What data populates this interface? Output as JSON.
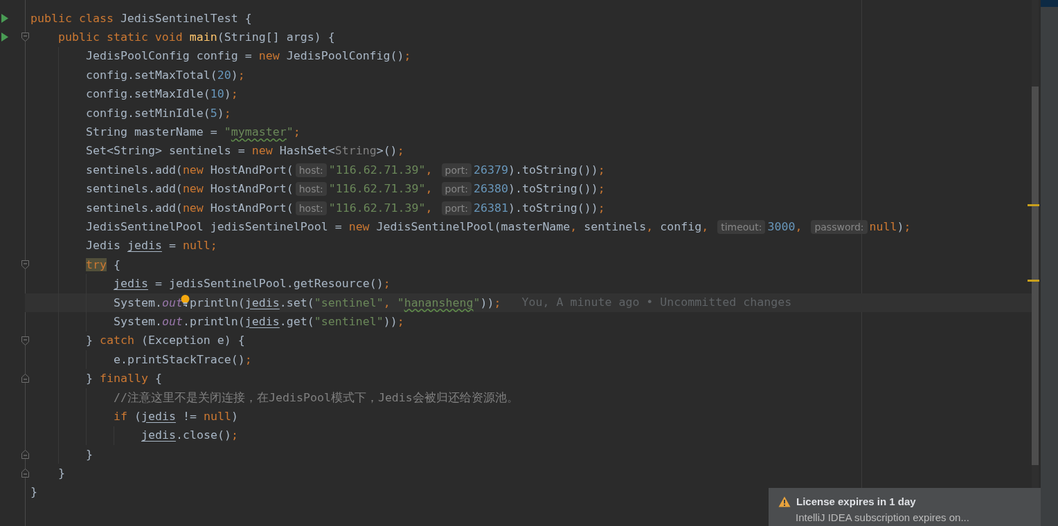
{
  "editor": {
    "lines": [
      {
        "run": true,
        "fold_start": false,
        "fold_end": false,
        "current": false,
        "tokens": [
          {
            "kind": "keyword",
            "text": "public class "
          },
          {
            "kind": "plain",
            "text": "JedisSentinelTest {"
          }
        ],
        "children": [
          {
            "run": true,
            "fold_start": true,
            "fold_end": false,
            "current": false,
            "tokens": [
              {
                "kind": "keyword",
                "text": "public static void "
              },
              {
                "kind": "method",
                "text": "main"
              },
              {
                "kind": "plain",
                "text": "(String[] args) {"
              }
            ],
            "children": [
              {
                "run": false,
                "fold_start": false,
                "fold_end": false,
                "current": false,
                "tokens": [
                  {
                    "kind": "plain",
                    "text": "JedisPoolConfig config = "
                  },
                  {
                    "kind": "keyword",
                    "text": "new "
                  },
                  {
                    "kind": "plain",
                    "text": "JedisPoolConfig()"
                  },
                  {
                    "kind": "punct",
                    "text": ";"
                  }
                ]
              },
              {
                "run": false,
                "fold_start": false,
                "fold_end": false,
                "current": false,
                "tokens": [
                  {
                    "kind": "plain",
                    "text": "config.setMaxTotal("
                  },
                  {
                    "kind": "number",
                    "text": "20"
                  },
                  {
                    "kind": "plain",
                    "text": ")"
                  },
                  {
                    "kind": "punct",
                    "text": ";"
                  }
                ]
              },
              {
                "run": false,
                "fold_start": false,
                "fold_end": false,
                "current": false,
                "tokens": [
                  {
                    "kind": "plain",
                    "text": "config.setMaxIdle("
                  },
                  {
                    "kind": "number",
                    "text": "10"
                  },
                  {
                    "kind": "plain",
                    "text": ")"
                  },
                  {
                    "kind": "punct",
                    "text": ";"
                  }
                ]
              },
              {
                "run": false,
                "fold_start": false,
                "fold_end": false,
                "current": false,
                "tokens": [
                  {
                    "kind": "plain",
                    "text": "config.setMinIdle("
                  },
                  {
                    "kind": "number",
                    "text": "5"
                  },
                  {
                    "kind": "plain",
                    "text": ")"
                  },
                  {
                    "kind": "punct",
                    "text": ";"
                  }
                ]
              },
              {
                "run": false,
                "fold_start": false,
                "fold_end": false,
                "current": false,
                "tokens": [
                  {
                    "kind": "plain",
                    "text": "String masterName = "
                  },
                  {
                    "kind": "string",
                    "text": "\""
                  },
                  {
                    "kind": "typo",
                    "text": "mymaster"
                  },
                  {
                    "kind": "string",
                    "text": "\""
                  },
                  {
                    "kind": "punct",
                    "text": ";"
                  }
                ]
              },
              {
                "run": false,
                "fold_start": false,
                "fold_end": false,
                "current": false,
                "tokens": [
                  {
                    "kind": "plain",
                    "text": "Set<String> sentinels = "
                  },
                  {
                    "kind": "keyword",
                    "text": "new "
                  },
                  {
                    "kind": "plain",
                    "text": "HashSet<"
                  },
                  {
                    "kind": "inferred",
                    "text": "String"
                  },
                  {
                    "kind": "plain",
                    "text": ">()"
                  },
                  {
                    "kind": "punct",
                    "text": ";"
                  }
                ]
              },
              {
                "run": false,
                "fold_start": false,
                "fold_end": false,
                "current": false,
                "tokens": [
                  {
                    "kind": "plain",
                    "text": "sentinels.add("
                  },
                  {
                    "kind": "keyword",
                    "text": "new "
                  },
                  {
                    "kind": "plain",
                    "text": "HostAndPort("
                  },
                  {
                    "kind": "hint",
                    "text": "host:"
                  },
                  {
                    "kind": "string",
                    "text": "\"116.62.71.39\""
                  },
                  {
                    "kind": "punct",
                    "text": ", "
                  },
                  {
                    "kind": "hint",
                    "text": "port:"
                  },
                  {
                    "kind": "number",
                    "text": "26379"
                  },
                  {
                    "kind": "plain",
                    "text": ").toString())"
                  },
                  {
                    "kind": "punct",
                    "text": ";"
                  }
                ]
              },
              {
                "run": false,
                "fold_start": false,
                "fold_end": false,
                "current": false,
                "tokens": [
                  {
                    "kind": "plain",
                    "text": "sentinels.add("
                  },
                  {
                    "kind": "keyword",
                    "text": "new "
                  },
                  {
                    "kind": "plain",
                    "text": "HostAndPort("
                  },
                  {
                    "kind": "hint",
                    "text": "host:"
                  },
                  {
                    "kind": "string",
                    "text": "\"116.62.71.39\""
                  },
                  {
                    "kind": "punct",
                    "text": ", "
                  },
                  {
                    "kind": "hint",
                    "text": "port:"
                  },
                  {
                    "kind": "number",
                    "text": "26380"
                  },
                  {
                    "kind": "plain",
                    "text": ").toString())"
                  },
                  {
                    "kind": "punct",
                    "text": ";"
                  }
                ]
              },
              {
                "run": false,
                "fold_start": false,
                "fold_end": false,
                "current": false,
                "tokens": [
                  {
                    "kind": "plain",
                    "text": "sentinels.add("
                  },
                  {
                    "kind": "keyword",
                    "text": "new "
                  },
                  {
                    "kind": "plain",
                    "text": "HostAndPort("
                  },
                  {
                    "kind": "hint",
                    "text": "host:"
                  },
                  {
                    "kind": "string",
                    "text": "\"116.62.71.39\""
                  },
                  {
                    "kind": "punct",
                    "text": ", "
                  },
                  {
                    "kind": "hint",
                    "text": "port:"
                  },
                  {
                    "kind": "number",
                    "text": "26381"
                  },
                  {
                    "kind": "plain",
                    "text": ").toString())"
                  },
                  {
                    "kind": "punct",
                    "text": ";"
                  }
                ]
              },
              {
                "run": false,
                "fold_start": false,
                "fold_end": false,
                "current": false,
                "tokens": [
                  {
                    "kind": "plain",
                    "text": "JedisSentinelPool jedisSentinelPool = "
                  },
                  {
                    "kind": "keyword",
                    "text": "new "
                  },
                  {
                    "kind": "plain",
                    "text": "JedisSentinelPool(masterName"
                  },
                  {
                    "kind": "punct",
                    "text": ", "
                  },
                  {
                    "kind": "plain",
                    "text": "sentinels"
                  },
                  {
                    "kind": "punct",
                    "text": ", "
                  },
                  {
                    "kind": "plain",
                    "text": "config"
                  },
                  {
                    "kind": "punct",
                    "text": ", "
                  },
                  {
                    "kind": "hint",
                    "text": "timeout:"
                  },
                  {
                    "kind": "number",
                    "text": "3000"
                  },
                  {
                    "kind": "punct",
                    "text": ", "
                  },
                  {
                    "kind": "hint",
                    "text": "password:"
                  },
                  {
                    "kind": "keyword",
                    "text": "null"
                  },
                  {
                    "kind": "plain",
                    "text": ")"
                  },
                  {
                    "kind": "punct",
                    "text": ";"
                  }
                ]
              },
              {
                "run": false,
                "fold_start": false,
                "fold_end": false,
                "current": false,
                "tokens": [
                  {
                    "kind": "plain",
                    "text": "Jedis "
                  },
                  {
                    "kind": "variable",
                    "text": "jedis"
                  },
                  {
                    "kind": "plain",
                    "text": " = "
                  },
                  {
                    "kind": "keyword",
                    "text": "null"
                  },
                  {
                    "kind": "punct",
                    "text": ";"
                  }
                ]
              },
              {
                "run": false,
                "fold_start": true,
                "fold_end": false,
                "current": false,
                "tokens": [
                  {
                    "kind": "keyword-match",
                    "text": "try"
                  },
                  {
                    "kind": "plain",
                    "text": " {"
                  }
                ],
                "children": [
                  {
                    "run": false,
                    "fold_start": false,
                    "fold_end": false,
                    "current": false,
                    "tokens": [
                      {
                        "kind": "variable",
                        "text": "jedis"
                      },
                      {
                        "kind": "plain",
                        "text": " = jedisSentinelPool.getResource()"
                      },
                      {
                        "kind": "punct",
                        "text": ";"
                      }
                    ]
                  },
                  {
                    "run": false,
                    "fold_start": false,
                    "fold_end": false,
                    "current": true,
                    "tokens": [
                      {
                        "kind": "plain",
                        "text": "System."
                      },
                      {
                        "kind": "field",
                        "text": "out"
                      },
                      {
                        "kind": "plain",
                        "text": ".println("
                      },
                      {
                        "kind": "variable",
                        "text": "jedis"
                      },
                      {
                        "kind": "plain",
                        "text": ".set("
                      },
                      {
                        "kind": "string",
                        "text": "\"sentinel\""
                      },
                      {
                        "kind": "punct",
                        "text": ", "
                      },
                      {
                        "kind": "string",
                        "text": "\""
                      },
                      {
                        "kind": "typo",
                        "text": "hanansheng"
                      },
                      {
                        "kind": "string",
                        "text": "\""
                      },
                      {
                        "kind": "plain",
                        "text": "))"
                      },
                      {
                        "kind": "punct",
                        "text": ";"
                      },
                      {
                        "kind": "blame",
                        "text": "You, A minute ago • Uncommitted changes"
                      }
                    ]
                  },
                  {
                    "run": false,
                    "fold_start": false,
                    "fold_end": false,
                    "current": false,
                    "tokens": [
                      {
                        "kind": "plain",
                        "text": "System."
                      },
                      {
                        "kind": "field",
                        "text": "out"
                      },
                      {
                        "kind": "plain",
                        "text": ".println("
                      },
                      {
                        "kind": "variable",
                        "text": "jedis"
                      },
                      {
                        "kind": "plain",
                        "text": ".get("
                      },
                      {
                        "kind": "string",
                        "text": "\"sentinel\""
                      },
                      {
                        "kind": "plain",
                        "text": "))"
                      },
                      {
                        "kind": "punct",
                        "text": ";"
                      }
                    ]
                  }
                ]
              },
              {
                "run": false,
                "fold_start": true,
                "fold_end": false,
                "current": false,
                "tokens": [
                  {
                    "kind": "plain",
                    "text": "} "
                  },
                  {
                    "kind": "keyword",
                    "text": "catch "
                  },
                  {
                    "kind": "plain",
                    "text": "(Exception e) {"
                  }
                ],
                "children": [
                  {
                    "run": false,
                    "fold_start": false,
                    "fold_end": false,
                    "current": false,
                    "tokens": [
                      {
                        "kind": "plain",
                        "text": "e.printStackTrace()"
                      },
                      {
                        "kind": "punct",
                        "text": ";"
                      }
                    ]
                  }
                ]
              },
              {
                "run": false,
                "fold_start": false,
                "fold_end": true,
                "current": false,
                "tokens": [
                  {
                    "kind": "plain",
                    "text": "} "
                  },
                  {
                    "kind": "keyword",
                    "text": "finally "
                  },
                  {
                    "kind": "plain",
                    "text": "{"
                  }
                ],
                "children": [
                  {
                    "run": false,
                    "fold_start": false,
                    "fold_end": false,
                    "current": false,
                    "tokens": [
                      {
                        "kind": "comment",
                        "text": "//注意这里不是关闭连接，在JedisPool模式下，Jedis会被归还给资源池。"
                      }
                    ]
                  },
                  {
                    "run": false,
                    "fold_start": false,
                    "fold_end": false,
                    "current": false,
                    "tokens": [
                      {
                        "kind": "keyword",
                        "text": "if "
                      },
                      {
                        "kind": "plain",
                        "text": "("
                      },
                      {
                        "kind": "variable",
                        "text": "jedis"
                      },
                      {
                        "kind": "plain",
                        "text": " != "
                      },
                      {
                        "kind": "keyword",
                        "text": "null"
                      },
                      {
                        "kind": "plain",
                        "text": ")"
                      }
                    ],
                    "children": [
                      {
                        "run": false,
                        "fold_start": false,
                        "fold_end": false,
                        "current": false,
                        "tokens": [
                          {
                            "kind": "variable",
                            "text": "jedis"
                          },
                          {
                            "kind": "plain",
                            "text": ".close()"
                          },
                          {
                            "kind": "punct",
                            "text": ";"
                          }
                        ]
                      }
                    ]
                  }
                ]
              },
              {
                "run": false,
                "fold_start": false,
                "fold_end": true,
                "current": false,
                "tokens": [
                  {
                    "kind": "plain",
                    "text": "}"
                  }
                ]
              }
            ]
          },
          {
            "run": false,
            "fold_start": false,
            "fold_end": true,
            "current": false,
            "tokens": [
              {
                "kind": "plain",
                "text": "}"
              }
            ]
          }
        ]
      },
      {
        "run": false,
        "fold_start": false,
        "fold_end": false,
        "current": false,
        "tokens": [
          {
            "kind": "plain",
            "text": "}"
          }
        ]
      }
    ]
  },
  "notification": {
    "title": "License expires in 1 day",
    "body": "IntelliJ IDEA subscription expires on..."
  }
}
